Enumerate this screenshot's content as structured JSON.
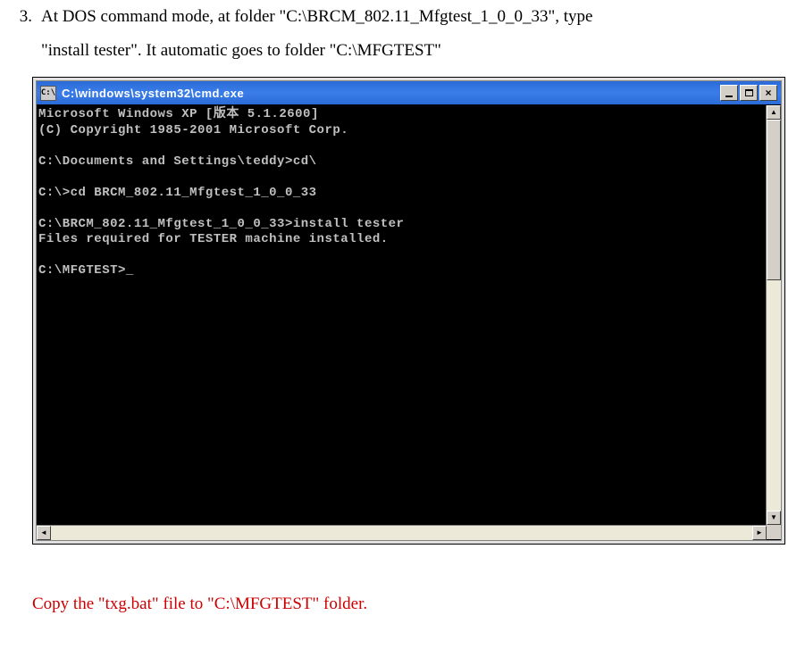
{
  "list": {
    "number": "3.",
    "text_line1": "At DOS command mode, at folder \"C:\\BRCM_802.11_Mfgtest_1_0_0_33\", type",
    "text_line2": "\"install tester\". It automatic goes to folder \"C:\\MFGTEST\""
  },
  "cmd_window": {
    "icon_text": "C:\\",
    "title": "C:\\windows\\system32\\cmd.exe",
    "buttons": {
      "close": "×"
    },
    "terminal_lines": [
      "Microsoft Windows XP [版本 5.1.2600]",
      "(C) Copyright 1985-2001 Microsoft Corp.",
      "",
      "C:\\Documents and Settings\\teddy>cd\\",
      "",
      "C:\\>cd BRCM_802.11_Mfgtest_1_0_0_33",
      "",
      "C:\\BRCM_802.11_Mfgtest_1_0_0_33>install tester",
      "Files required for TESTER machine installed.",
      "",
      "C:\\MFGTEST>_"
    ]
  },
  "red_note": "Copy the \"txg.bat\" file to \"C:\\MFGTEST\" folder."
}
